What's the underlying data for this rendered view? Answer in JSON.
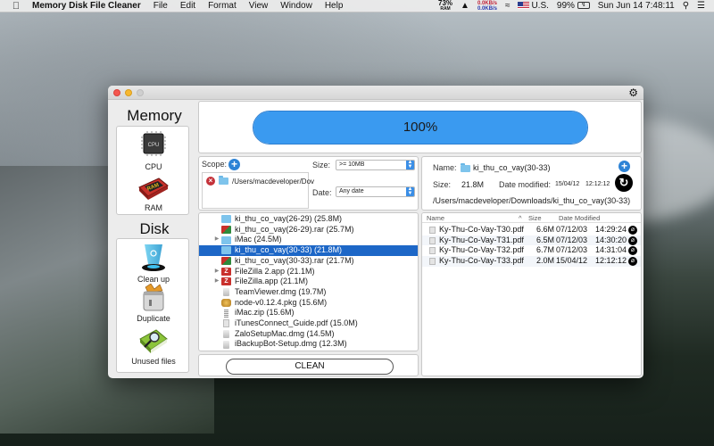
{
  "menubar": {
    "app_name": "Memory Disk File Cleaner",
    "menus": [
      "File",
      "Edit",
      "Format",
      "View",
      "Window",
      "Help"
    ],
    "ram_percent": "73%",
    "ram_label": "RAM",
    "net_up": "0.0KB/s",
    "net_down": "0.0KB/s",
    "input_source": "U.S.",
    "battery": "99%",
    "datetime": "Sun Jun 14  7:48:11"
  },
  "sidebar": {
    "memory_title": "Memory",
    "memory_tools": [
      {
        "label": "CPU"
      },
      {
        "label": "RAM"
      }
    ],
    "disk_title": "Disk",
    "disk_tools": [
      {
        "label": "Clean up"
      },
      {
        "label": "Duplicate"
      },
      {
        "label": "Unused files"
      }
    ]
  },
  "progress": {
    "value": 100,
    "label": "100%",
    "color": "#3a9af0"
  },
  "filters": {
    "scope_label": "Scope:",
    "scope_paths": [
      "/Users/macdeveloper/Downloads"
    ],
    "scope_path_display": "/Users/macdeveloper/Dov",
    "size_label": "Size:",
    "size_value": ">= 10MB",
    "date_label": "Date:",
    "date_value": "Any date"
  },
  "file_list": [
    {
      "name": "ki_thu_co_vay(26-29) (25.8M)",
      "type": "folder",
      "expandable": false,
      "selected": false
    },
    {
      "name": "ki_thu_co_vay(26-29).rar (25.7M)",
      "type": "rar",
      "expandable": false,
      "selected": false
    },
    {
      "name": "iMac (24.5M)",
      "type": "folder",
      "expandable": true,
      "selected": false
    },
    {
      "name": "ki_thu_co_vay(30-33) (21.8M)",
      "type": "folder",
      "expandable": false,
      "selected": true
    },
    {
      "name": "ki_thu_co_vay(30-33).rar (21.7M)",
      "type": "rar",
      "expandable": false,
      "selected": false
    },
    {
      "name": "FileZilla 2.app (21.1M)",
      "type": "app",
      "expandable": true,
      "selected": false
    },
    {
      "name": "FileZilla.app (21.1M)",
      "type": "app",
      "expandable": true,
      "selected": false
    },
    {
      "name": "TeamViewer.dmg (19.7M)",
      "type": "dmg",
      "expandable": false,
      "selected": false
    },
    {
      "name": "node-v0.12.4.pkg (15.6M)",
      "type": "pkg",
      "expandable": false,
      "selected": false
    },
    {
      "name": "iMac.zip (15.6M)",
      "type": "zip",
      "expandable": false,
      "selected": false
    },
    {
      "name": "iTunesConnect_Guide.pdf (15.0M)",
      "type": "pdf",
      "expandable": false,
      "selected": false
    },
    {
      "name": "ZaloSetupMac.dmg (14.5M)",
      "type": "dmg",
      "expandable": false,
      "selected": false
    },
    {
      "name": "iBackupBot-Setup.dmg (12.3M)",
      "type": "dmg",
      "expandable": false,
      "selected": false
    }
  ],
  "clean_button": "CLEAN",
  "details": {
    "name_label": "Name:",
    "name_value": "ki_thu_co_vay(30-33)",
    "size_label": "Size:",
    "size_value": "21.8M",
    "date_label": "Date modified:",
    "date_value": "15/04/12",
    "time_value": "12:12:12",
    "path": "/Users/macdeveloper/Downloads/ki_thu_co_vay(30-33)"
  },
  "contents_table": {
    "columns": {
      "name": "Name",
      "size": "Size",
      "date": "Date Modified"
    },
    "sort_indicator": "^",
    "rows": [
      {
        "name": "Ky-Thu-Co-Vay-T30.pdf",
        "size": "6.6M",
        "date": "07/12/03",
        "time": "14:29:24"
      },
      {
        "name": "Ky-Thu-Co-Vay-T31.pdf",
        "size": "6.5M",
        "date": "07/12/03",
        "time": "14:30:20"
      },
      {
        "name": "Ky-Thu-Co-Vay-T32.pdf",
        "size": "6.7M",
        "date": "07/12/03",
        "time": "14:31:04"
      },
      {
        "name": "Ky-Thu-Co-Vay-T33.pdf",
        "size": "2.0M",
        "date": "15/04/12",
        "time": "12:12:12"
      }
    ]
  }
}
